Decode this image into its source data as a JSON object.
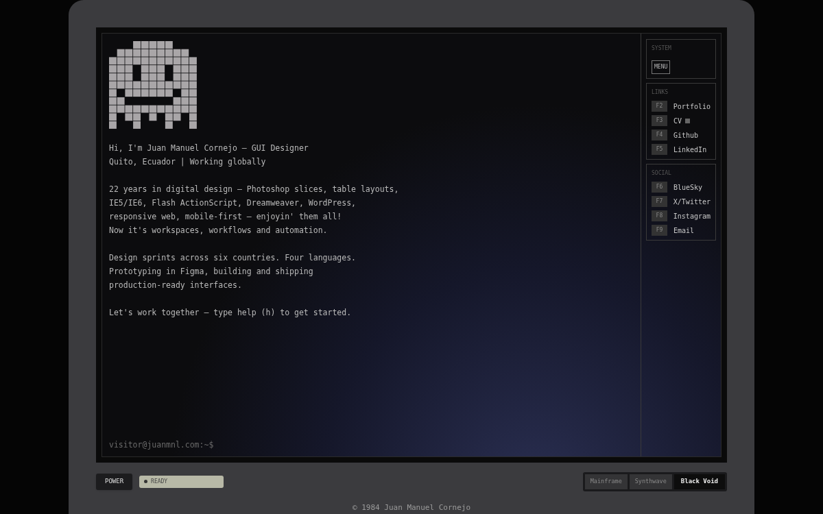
{
  "terminal": {
    "paragraphs": [
      [
        "Hi, I'm Juan Manuel Cornejo — GUI Designer",
        "Quito, Ecuador | Working globally"
      ],
      [
        "22 years in digital design — Photoshop slices, table layouts,",
        "IE5/IE6, Flash ActionScript, Dreamweaver, WordPress,",
        "responsive web, mobile-first — enjoyin' them all!",
        "Now it's workspaces, workflows and automation."
      ],
      [
        "Design sprints across six countries. Four languages.",
        "Prototyping in Figma, building and shipping",
        "production-ready interfaces."
      ],
      [
        "Let's work together — type help (h) to get started."
      ]
    ],
    "prompt": "visitor@juanmnl.com:~$"
  },
  "sidebar": [
    {
      "title": "SYSTEM",
      "kind": "menu",
      "button": "MENU"
    },
    {
      "title": "LINKS",
      "kind": "keys",
      "items": [
        {
          "key": "F2",
          "label": "Portfolio"
        },
        {
          "key": "F3",
          "label": "CV",
          "badge": true
        },
        {
          "key": "F4",
          "label": "Github"
        },
        {
          "key": "F5",
          "label": "LinkedIn"
        }
      ]
    },
    {
      "title": "SOCIAL",
      "kind": "keys",
      "items": [
        {
          "key": "F6",
          "label": "BlueSky"
        },
        {
          "key": "F7",
          "label": "X/Twitter"
        },
        {
          "key": "F8",
          "label": "Instagram"
        },
        {
          "key": "F9",
          "label": "Email"
        }
      ]
    }
  ],
  "controls": {
    "power": "POWER",
    "status": "READY"
  },
  "themes": [
    {
      "label": "Mainframe",
      "selected": false
    },
    {
      "label": "Synthwave",
      "selected": false
    },
    {
      "label": "Black Void",
      "selected": true
    }
  ],
  "footer": "© 1984 Juan Manuel Cornejo"
}
